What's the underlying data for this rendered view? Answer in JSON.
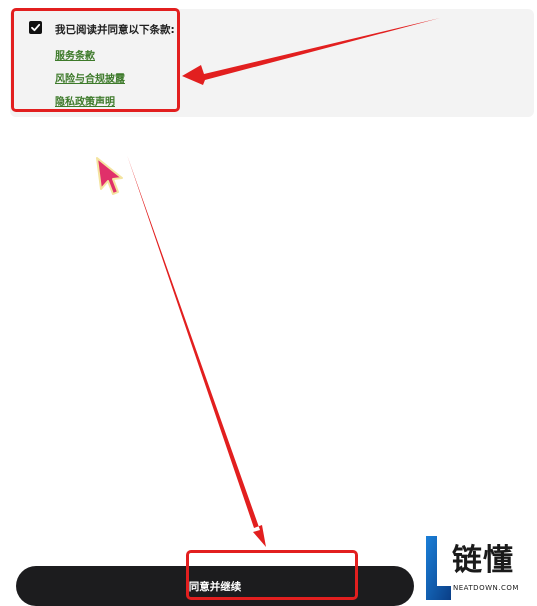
{
  "terms": {
    "checkbox_checked": true,
    "title": "我已阅读并同意以下条款:",
    "links": [
      "服务条款",
      "风险与合规披露",
      "隐私政策声明"
    ],
    "link_color": "#3d7a2a"
  },
  "continue_button": {
    "label": "同意并继续",
    "background": "#1c1c1e"
  },
  "annotations": {
    "highlight_color": "#e21f1f",
    "cursor_color": "#e0306a"
  },
  "watermark": {
    "name": "链懂",
    "url": "NEATDOWN.COM"
  }
}
